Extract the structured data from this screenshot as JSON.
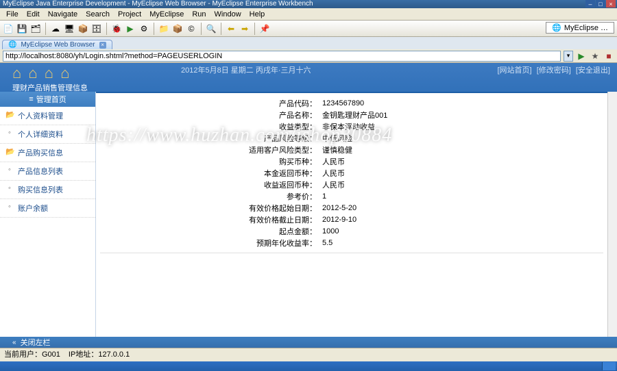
{
  "window": {
    "title": "MyEclipse Java Enterprise Development - MyEclipse Web Browser - MyEclipse Enterprise Workbench",
    "controls": {
      "min": "–",
      "max": "□",
      "close": "×"
    }
  },
  "menu": {
    "items": [
      "File",
      "Edit",
      "Navigate",
      "Search",
      "Project",
      "MyEclipse",
      "Run",
      "Window",
      "Help"
    ]
  },
  "toolbar_tag": "MyEclipse …",
  "tab": {
    "label": "MyEclipse Web Browser",
    "close": "×"
  },
  "address": {
    "url": "http://localhost:8080/yh/Login.shtml?method=PAGEUSERLOGIN",
    "go": "▶",
    "stop": "■",
    "dd": "▾"
  },
  "banner": {
    "home_glyphs": "⌂ ⌂ ⌂ ⌂",
    "sys_title": "理财产品销售管理信息",
    "date": "2012年5月8日 星期二 丙戌年·三月十六",
    "links": [
      "[网站首页]",
      "[修改密码]",
      "[安全退出]"
    ]
  },
  "watermark": "https://www.huzhan.com/ishop30884",
  "sidebar": {
    "header_icon": "≡",
    "header": "管理首页",
    "items": [
      {
        "label": "个人资料管理",
        "type": "folder"
      },
      {
        "label": "个人详细资料",
        "type": "bullet"
      },
      {
        "label": "产品购买信息",
        "type": "folder"
      },
      {
        "label": "产品信息列表",
        "type": "bullet"
      },
      {
        "label": "购买信息列表",
        "type": "bullet"
      },
      {
        "label": "账户余额",
        "type": "bullet"
      }
    ]
  },
  "details": {
    "rows": [
      {
        "label": "产品代码：",
        "value": "1234567890"
      },
      {
        "label": "产品名称：",
        "value": "金钥匙理财产品001"
      },
      {
        "label": "收益类型：",
        "value": "非保本浮动收益"
      },
      {
        "label": "产品风险等级：",
        "value": "中低风险"
      },
      {
        "label": "适用客户风险类型：",
        "value": "谨慎稳健"
      },
      {
        "label": "购买币种：",
        "value": "人民币"
      },
      {
        "label": "本金返回币种：",
        "value": "人民币"
      },
      {
        "label": "收益返回币种：",
        "value": "人民币"
      },
      {
        "label": "参考价：",
        "value": "1"
      },
      {
        "label": "有效价格起始日期：",
        "value": "2012-5-20"
      },
      {
        "label": "有效价格截止日期：",
        "value": "2012-9-10"
      },
      {
        "label": "起点金额：",
        "value": "1000"
      },
      {
        "label": "预期年化收益率：",
        "value": "5.5"
      }
    ]
  },
  "close_bar": {
    "arrows": "«",
    "label": "关闭左栏"
  },
  "status": {
    "user_label": "当前用户：",
    "user": "G001",
    "ip_label": "IP地址：",
    "ip": "127.0.0.1"
  }
}
